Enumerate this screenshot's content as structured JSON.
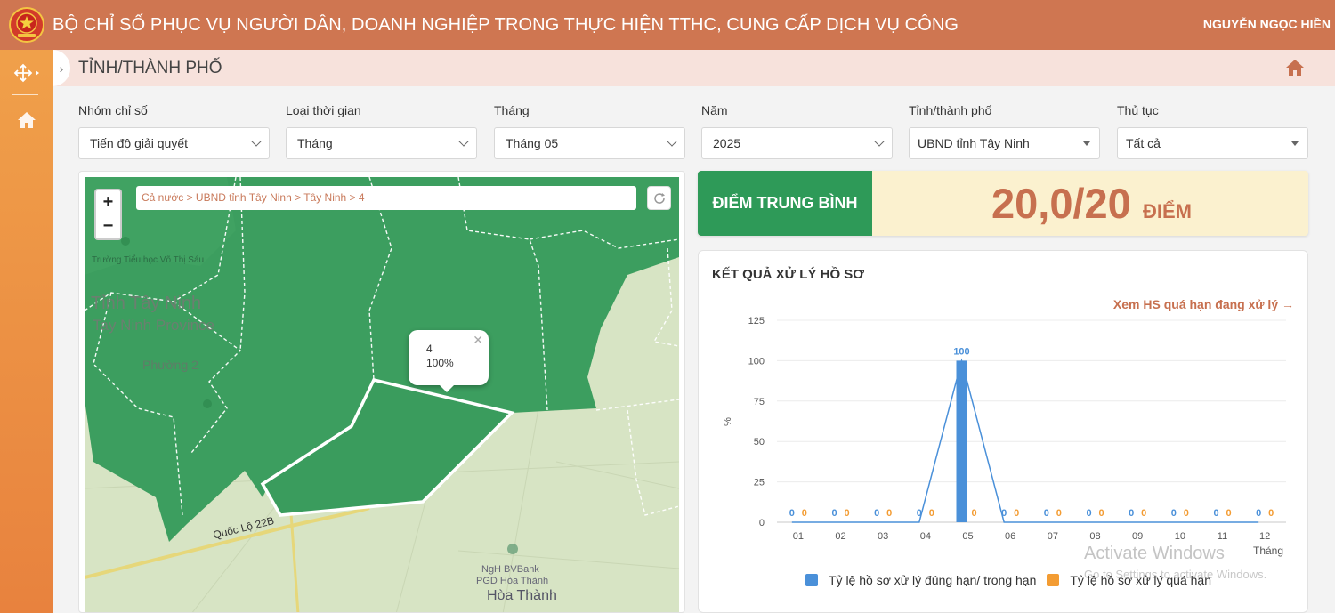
{
  "header": {
    "title": "BỘ CHỈ SỐ PHỤC VỤ NGƯỜI DÂN, DOANH NGHIỆP TRONG THỰC HIỆN TTHC, CUNG CẤP DỊCH VỤ CÔNG",
    "user": "NGUYỄN NGỌC HIỀN"
  },
  "page": {
    "title": "TỈNH/THÀNH PHỐ"
  },
  "filters": [
    {
      "label": "Nhóm chỉ số",
      "value": "Tiến độ giải quyết"
    },
    {
      "label": "Loại thời gian",
      "value": "Tháng"
    },
    {
      "label": "Tháng",
      "value": "Tháng 05"
    },
    {
      "label": "Năm",
      "value": "2025"
    },
    {
      "label": "Tỉnh/thành phố",
      "value": "UBND tỉnh Tây Ninh"
    },
    {
      "label": "Thủ tục",
      "value": "Tất cả"
    }
  ],
  "map": {
    "breadcrumb": "Cả nước > UBND tỉnh Tây Ninh > Tây Ninh > 4",
    "zoom_in": "+",
    "zoom_out": "−",
    "popup": {
      "name": "4",
      "value": "100%"
    },
    "labels": {
      "province_vi": "Tỉnh Tây Ninh",
      "province_en": "Tay Ninh Province",
      "ward": "Phường 2",
      "school": "Trường Tiểu học Võ Thị Sáu",
      "road": "Quốc Lộ 22B",
      "bank1": "NgH BVBank",
      "bank2": "PGD Hòa Thành",
      "town": "Hòa Thành"
    }
  },
  "score": {
    "label": "ĐIỂM TRUNG BÌNH",
    "value": "20,0/20",
    "unit": "ĐIỂM"
  },
  "result": {
    "title": "KẾT QUẢ XỬ LÝ HỒ SƠ",
    "link": "Xem HS quá hạn đang xử lý →"
  },
  "watermark": {
    "line1": "Activate Windows",
    "line2": "Go to Settings to activate Windows."
  },
  "chart_data": {
    "type": "bar",
    "categories": [
      "01",
      "02",
      "03",
      "04",
      "05",
      "06",
      "07",
      "08",
      "09",
      "10",
      "11",
      "12"
    ],
    "series": [
      {
        "name": "Tỷ lệ hồ sơ xử lý đúng hạn/ trong hạn",
        "values": [
          0,
          0,
          0,
          0,
          100,
          0,
          0,
          0,
          0,
          0,
          0,
          0
        ],
        "color": "#4a90d9"
      },
      {
        "name": "Tỷ lệ hồ sơ xử lý quá hạn",
        "values": [
          0,
          0,
          0,
          0,
          0,
          0,
          0,
          0,
          0,
          0,
          0,
          0
        ],
        "color": "#f39c33"
      }
    ],
    "ylabel": "%",
    "xlabel": "Tháng",
    "ylim": [
      0,
      125
    ],
    "yticks": [
      0,
      25,
      50,
      75,
      100,
      125
    ],
    "line_overlay": true,
    "grid": true,
    "legend": "bottom"
  },
  "colors": {
    "header": "#cf7651",
    "accent_green": "#2e9a58",
    "score_text": "#c7704f",
    "map_district": "#3a9e5e"
  }
}
